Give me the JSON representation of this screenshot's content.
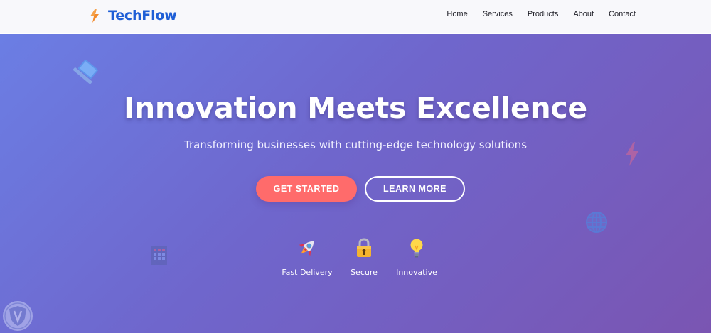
{
  "brand": {
    "name": "TechFlow",
    "logo_icon": "lightning-bolt-icon"
  },
  "nav": {
    "links": [
      {
        "label": "Home"
      },
      {
        "label": "Services"
      },
      {
        "label": "Products"
      },
      {
        "label": "About"
      },
      {
        "label": "Contact"
      }
    ]
  },
  "hero": {
    "title": "Innovation Meets Excellence",
    "subtitle": "Transforming businesses with cutting-edge technology solutions",
    "primary_button": "GET STARTED",
    "secondary_button": "LEARN MORE",
    "features": [
      {
        "label": "Fast Delivery",
        "icon": "rocket-icon"
      },
      {
        "label": "Secure",
        "icon": "lock-icon"
      },
      {
        "label": "Innovative",
        "icon": "lightbulb-icon"
      }
    ]
  },
  "colors": {
    "brand": "#1f5fd6",
    "accent": "#ff6b6b",
    "gradient_start": "#6b7ee4",
    "gradient_end": "#7a55b2"
  }
}
